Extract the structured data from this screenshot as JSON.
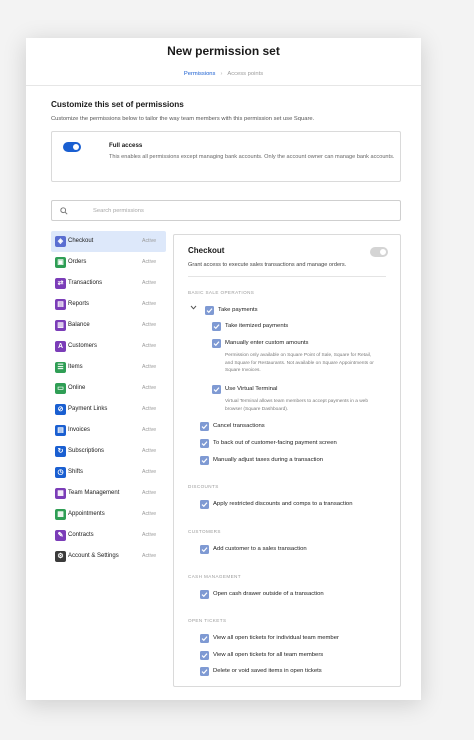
{
  "page": {
    "title": "New permission set",
    "breadcrumbs": [
      "Permissions",
      "Access points"
    ],
    "section_title": "Customize this set of permissions",
    "section_desc": "Customize the permissions below to tailor the way team members with this permission set use Square."
  },
  "full_access": {
    "label": "Full access",
    "desc": "This enables all permissions except managing bank accounts. Only the account owner can manage bank accounts.",
    "enabled": true
  },
  "search": {
    "placeholder": "Search permissions"
  },
  "sidebar": {
    "items": [
      {
        "label": "Checkout",
        "status": "Active",
        "icon": "checkout-icon",
        "color": "#5a6ed1",
        "glyph": "◈",
        "selected": true
      },
      {
        "label": "Orders",
        "status": "Active",
        "icon": "orders-icon",
        "color": "#2f9e55",
        "glyph": "▣"
      },
      {
        "label": "Transactions",
        "status": "Active",
        "icon": "transactions-icon",
        "color": "#7b3db8",
        "glyph": "⇄"
      },
      {
        "label": "Reports",
        "status": "Active",
        "icon": "reports-icon",
        "color": "#7b3db8",
        "glyph": "▤"
      },
      {
        "label": "Balance",
        "status": "Active",
        "icon": "balance-icon",
        "color": "#7b3db8",
        "glyph": "▥"
      },
      {
        "label": "Customers",
        "status": "Active",
        "icon": "customers-icon",
        "color": "#7b3db8",
        "glyph": "A"
      },
      {
        "label": "Items",
        "status": "Active",
        "icon": "items-icon",
        "color": "#2f9e55",
        "glyph": "☰"
      },
      {
        "label": "Online",
        "status": "Active",
        "icon": "online-icon",
        "color": "#2f9e55",
        "glyph": "▭"
      },
      {
        "label": "Payment Links",
        "status": "Active",
        "icon": "payment-links-icon",
        "color": "#1a5fd1",
        "glyph": "⊘"
      },
      {
        "label": "Invoices",
        "status": "Active",
        "icon": "invoices-icon",
        "color": "#1a5fd1",
        "glyph": "▤"
      },
      {
        "label": "Subscriptions",
        "status": "Active",
        "icon": "subscriptions-icon",
        "color": "#1a5fd1",
        "glyph": "↻"
      },
      {
        "label": "Shifts",
        "status": "Active",
        "icon": "shifts-icon",
        "color": "#1a5fd1",
        "glyph": "◷"
      },
      {
        "label": "Team Management",
        "status": "Active",
        "icon": "team-management-icon",
        "color": "#7b3db8",
        "glyph": "▦"
      },
      {
        "label": "Appointments",
        "status": "Active",
        "icon": "appointments-icon",
        "color": "#2f9e55",
        "glyph": "▦"
      },
      {
        "label": "Contracts",
        "status": "Active",
        "icon": "contracts-icon",
        "color": "#7b3db8",
        "glyph": "✎"
      },
      {
        "label": "Account & Settings",
        "status": "Active",
        "icon": "account-settings-icon",
        "color": "#3b3b3b",
        "glyph": "⚙"
      }
    ]
  },
  "checkout": {
    "title": "Checkout",
    "desc": "Grant access to execute sales transactions and manage orders.",
    "enabled": false,
    "sections": {
      "basic": "BASIC SALE OPERATIONS",
      "discounts": "DISCOUNTS",
      "customers": "CUSTOMERS",
      "cash": "CASH MANAGEMENT",
      "tickets": "OPEN TICKETS"
    },
    "perms": {
      "take_payments": "Take payments",
      "itemized": "Take itemized payments",
      "custom_amounts": "Manually enter custom amounts",
      "custom_note": "Permission only available on Square Point of Sale, Square for Retail, and Square for Restaurants. Not available on Square Appointments or Square Invoices.",
      "virtual_terminal": "Use Virtual Terminal",
      "vt_note": "Virtual Terminal allows team members to accept payments in a web browser (Square Dashboard).",
      "cancel": "Cancel transactions",
      "back_out": "To back out of customer-facing payment screen",
      "taxes": "Manually adjust taxes during a transaction",
      "discounts": "Apply restricted discounts and comps to a transaction",
      "add_customer": "Add customer to a sales transaction",
      "cash_drawer": "Open cash drawer outside of a transaction",
      "view_own": "View all open tickets for individual team member",
      "view_all": "View all open tickets for all team members",
      "delete_void": "Delete or void saved items in open tickets"
    }
  }
}
